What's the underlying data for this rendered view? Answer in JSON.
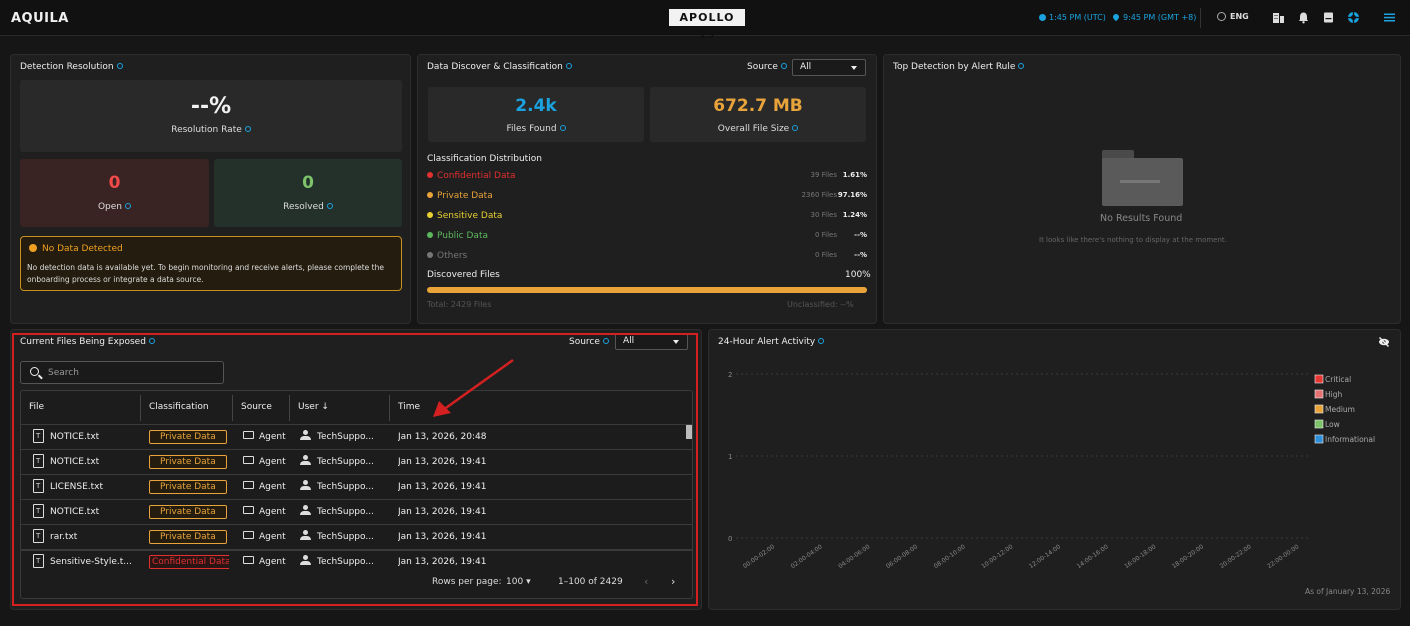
{
  "topbar": {
    "brand": "AQUILA",
    "center_logo": "APOLLO 13",
    "time_utc": "1:45 PM (UTC)",
    "time_local": "9:45 PM (GMT +8)",
    "language": "ENG"
  },
  "detection": {
    "title": "Detection Resolution",
    "rate_value": "--%",
    "rate_label": "Resolution Rate",
    "open_value": "0",
    "open_label": "Open",
    "resolved_value": "0",
    "resolved_label": "Resolved",
    "warning_title": "No Data Detected",
    "warning_text": "No detection data is available yet. To begin monitoring and receive alerts, please complete the onboarding process or integrate a data source."
  },
  "discover": {
    "title": "Data Discover & Classification",
    "source_label": "Source",
    "source_value": "All",
    "files_found_value": "2.4k",
    "files_found_label": "Files Found",
    "file_size_value": "672.7 MB",
    "file_size_label": "Overall File Size",
    "dist_title": "Classification Distribution",
    "distribution": [
      {
        "label": "Confidential Data",
        "files": "39 Files",
        "pct": "1.61%",
        "color": "#e03030"
      },
      {
        "label": "Private Data",
        "files": "2360 Files",
        "pct": "97.16%",
        "color": "#e8a33a"
      },
      {
        "label": "Sensitive Data",
        "files": "30 Files",
        "pct": "1.24%",
        "color": "#e8d030"
      },
      {
        "label": "Public Data",
        "files": "0 Files",
        "pct": "--%",
        "color": "#5cb85c"
      },
      {
        "label": "Others",
        "files": "0 Files",
        "pct": "--%",
        "color": "#777777"
      }
    ],
    "discovered_label": "Discovered Files",
    "discovered_pct": "100%",
    "discovered_fraction": 1.0,
    "total_label": "Total: 2429 Files",
    "unclassified_label": "Unclassified: --%"
  },
  "top_detection": {
    "title": "Top Detection by Alert Rule",
    "empty_title": "No Results Found",
    "empty_text": "It looks like there's nothing to display at the moment."
  },
  "exposed": {
    "title": "Current Files Being Exposed",
    "source_label": "Source",
    "source_value": "All",
    "search_placeholder": "Search",
    "columns": [
      "File",
      "Classification",
      "Source",
      "User",
      "Time"
    ],
    "rows": [
      {
        "file": "NOTICE.txt",
        "classification": "Private Data",
        "source": "Agent",
        "user": "TechSuppo...",
        "time": "Jan 13, 2026, 20:48"
      },
      {
        "file": "NOTICE.txt",
        "classification": "Private Data",
        "source": "Agent",
        "user": "TechSuppo...",
        "time": "Jan 13, 2026, 19:41"
      },
      {
        "file": "LICENSE.txt",
        "classification": "Private Data",
        "source": "Agent",
        "user": "TechSuppo...",
        "time": "Jan 13, 2026, 19:41"
      },
      {
        "file": "NOTICE.txt",
        "classification": "Private Data",
        "source": "Agent",
        "user": "TechSuppo...",
        "time": "Jan 13, 2026, 19:41"
      },
      {
        "file": "rar.txt",
        "classification": "Private Data",
        "source": "Agent",
        "user": "TechSuppo...",
        "time": "Jan 13, 2026, 19:41"
      },
      {
        "file": "Sensitive-Style.t...",
        "classification": "Confidential Data",
        "source": "Agent",
        "user": "TechSuppo...",
        "time": "Jan 13, 2026, 19:41"
      }
    ],
    "rows_per_page_label": "Rows per page:",
    "rows_per_page_value": "100",
    "range_label": "1–100 of 2429"
  },
  "alerts": {
    "title": "24-Hour Alert Activity",
    "as_of": "As of January 13, 2026"
  },
  "chart_data": {
    "type": "bar",
    "title": "24-Hour Alert Activity",
    "categories": [
      "00:00-02:00",
      "02:00-04:00",
      "04:00-06:00",
      "06:00-08:00",
      "08:00-10:00",
      "10:00-12:00",
      "12:00-14:00",
      "14:00-16:00",
      "16:00-18:00",
      "18:00-20:00",
      "20:00-22:00",
      "22:00-00:00"
    ],
    "y_ticks": [
      "2",
      "1",
      "0"
    ],
    "ylim": [
      0,
      2
    ],
    "series": [
      {
        "name": "Critical",
        "color": "#e53935",
        "values": [
          0,
          0,
          0,
          0,
          0,
          0,
          0,
          0,
          0,
          0,
          0,
          0
        ]
      },
      {
        "name": "High",
        "color": "#e57373",
        "values": [
          0,
          0,
          0,
          0,
          0,
          0,
          0,
          0,
          0,
          0,
          0,
          0
        ]
      },
      {
        "name": "Medium",
        "color": "#e8a33a",
        "values": [
          0,
          0,
          0,
          0,
          0,
          0,
          0,
          0,
          0,
          0,
          0,
          0
        ]
      },
      {
        "name": "Low",
        "color": "#7cc36b",
        "values": [
          0,
          0,
          0,
          0,
          0,
          0,
          0,
          0,
          0,
          0,
          0,
          0
        ]
      },
      {
        "name": "Informational",
        "color": "#2f8fd8",
        "values": [
          0,
          0,
          0,
          0,
          0,
          0,
          0,
          0,
          0,
          0,
          0,
          0
        ]
      }
    ],
    "legend": "right",
    "grid": true
  }
}
